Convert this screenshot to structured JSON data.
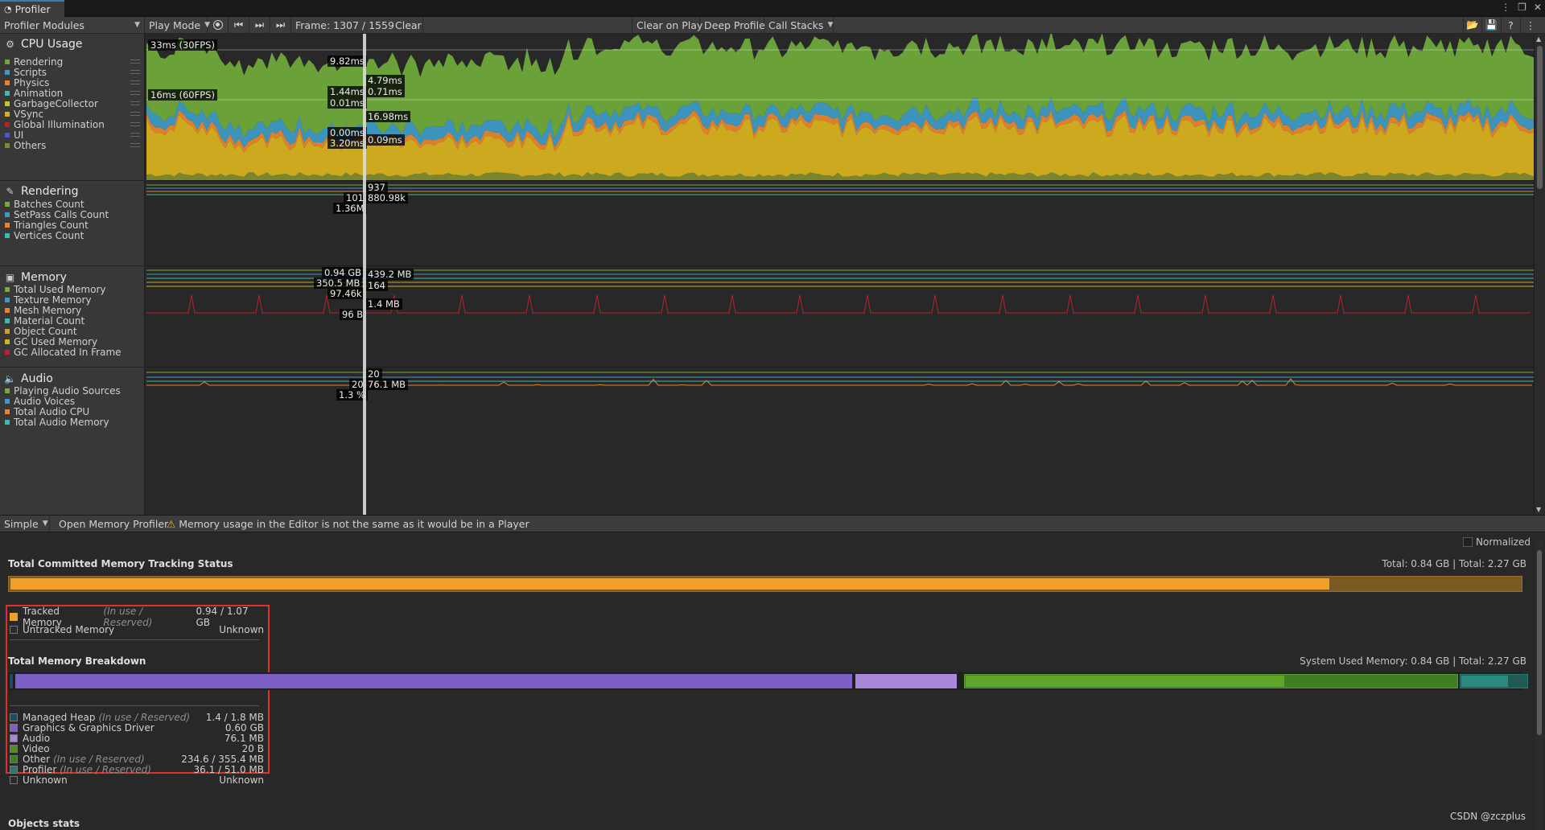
{
  "window": {
    "tab_title": "Profiler"
  },
  "toolbar": {
    "modules_label": "Profiler Modules",
    "play_mode": "Play Mode",
    "frame_label": "Frame: 1307 / 1559",
    "clear": "Clear",
    "clear_on_play": "Clear on Play",
    "deep_profile": "Deep Profile",
    "call_stacks": "Call Stacks"
  },
  "modules": {
    "cpu": {
      "title": "CPU Usage",
      "items": [
        {
          "label": "Rendering",
          "color": "#6ea83a"
        },
        {
          "label": "Scripts",
          "color": "#3d9ac4"
        },
        {
          "label": "Physics",
          "color": "#e8842c"
        },
        {
          "label": "Animation",
          "color": "#3fb8ad"
        },
        {
          "label": "GarbageCollector",
          "color": "#c9c427"
        },
        {
          "label": "VSync",
          "color": "#d6b020"
        },
        {
          "label": "Global Illumination",
          "color": "#b8222a"
        },
        {
          "label": "UI",
          "color": "#4a55c8"
        },
        {
          "label": "Others",
          "color": "#7e8a2e"
        }
      ]
    },
    "rendering": {
      "title": "Rendering",
      "items": [
        {
          "label": "Batches Count",
          "color": "#7aa63a"
        },
        {
          "label": "SetPass Calls Count",
          "color": "#3d9ac4"
        },
        {
          "label": "Triangles Count",
          "color": "#e8842c"
        },
        {
          "label": "Vertices Count",
          "color": "#3fb8ad"
        }
      ]
    },
    "memory": {
      "title": "Memory",
      "items": [
        {
          "label": "Total Used Memory",
          "color": "#7aa63a"
        },
        {
          "label": "Texture Memory",
          "color": "#3d9ac4"
        },
        {
          "label": "Mesh Memory",
          "color": "#e8842c"
        },
        {
          "label": "Material Count",
          "color": "#3fb8ad"
        },
        {
          "label": "Object Count",
          "color": "#c9a227"
        },
        {
          "label": "GC Used Memory",
          "color": "#d6b020"
        },
        {
          "label": "GC Allocated In Frame",
          "color": "#b8222a"
        }
      ]
    },
    "audio": {
      "title": "Audio",
      "items": [
        {
          "label": "Playing Audio Sources",
          "color": "#7aa63a"
        },
        {
          "label": "Audio Voices",
          "color": "#3d9ac4"
        },
        {
          "label": "Total Audio CPU",
          "color": "#e8842c"
        },
        {
          "label": "Total Audio Memory",
          "color": "#3fb8ad"
        }
      ]
    }
  },
  "cpu_labels": {
    "fps30": "33ms (30FPS)",
    "fps60": "16ms (60FPS)",
    "a": "9.82ms",
    "b": "1.44ms",
    "c": "0.01ms",
    "d": "0.00ms",
    "e": "3.20ms",
    "f": "4.79ms",
    "g": "0.71ms",
    "h": "16.98ms",
    "i": "0.09ms"
  },
  "rendering_labels": {
    "a": "937",
    "b": "101",
    "c": "880.98k",
    "d": "1.36M"
  },
  "memory_labels": {
    "a": "0.94 GB",
    "b": "350.5 MB",
    "c": "97.46k",
    "d": "96 B",
    "e": "439.2 MB",
    "f": "164",
    "g": "1.4 MB"
  },
  "audio_labels": {
    "a": "20",
    "b": "20",
    "c": "76.1 MB",
    "d": "1.3 %"
  },
  "bottombar": {
    "view_mode": "Simple",
    "open_memory_profiler": "Open Memory Profiler",
    "warning": "Memory usage in the Editor is not the same as it would be in a Player"
  },
  "detail": {
    "normalized": "Normalized",
    "tracking_title": "Total Committed Memory Tracking Status",
    "tracking_total": "Total: 0.84 GB | Total: 2.27 GB",
    "tracking_fraction": 0.875,
    "tracked": {
      "label": "Tracked Memory",
      "sub": "(In use / Reserved)",
      "value": "0.94 / 1.07 GB"
    },
    "untracked": {
      "label": "Untracked Memory",
      "value": "Unknown"
    },
    "breakdown_title": "Total Memory Breakdown",
    "breakdown_total": "System Used Memory: 0.84 GB | Total: 2.27 GB",
    "breakdown": [
      {
        "label": "Managed Heap",
        "sub": "(In use / Reserved)",
        "value": "1.4 / 1.8 MB",
        "color": "#1e4a63"
      },
      {
        "label": "Graphics & Graphics Driver",
        "sub": "",
        "value": "0.60 GB",
        "color": "#7d5fc6"
      },
      {
        "label": "Audio",
        "sub": "",
        "value": "76.1 MB",
        "color": "#a987d8"
      },
      {
        "label": "Video",
        "sub": "",
        "value": "20 B",
        "color": "#4e8d1f"
      },
      {
        "label": "Other",
        "sub": "(In use / Reserved)",
        "value": "234.6 / 355.4 MB",
        "color": "#3f7f22"
      },
      {
        "label": "Profiler",
        "sub": "(In use / Reserved)",
        "value": "36.1 / 51.0 MB",
        "color": "#2a7a72"
      },
      {
        "label": "Unknown",
        "sub": "",
        "value": "Unknown",
        "color": "#2b2b2b"
      }
    ],
    "objects_stats": "Objects stats",
    "watermark": "CSDN @zczplus"
  }
}
